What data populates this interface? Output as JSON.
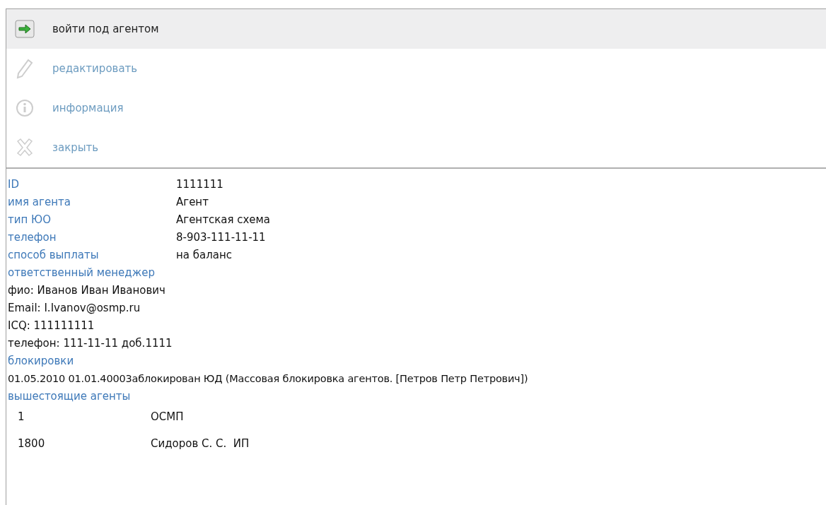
{
  "actions": [
    {
      "kind": "login",
      "label": "войти под агентом",
      "selected": true,
      "disabled": false
    },
    {
      "kind": "edit",
      "label": "редактировать",
      "selected": false,
      "disabled": true
    },
    {
      "kind": "info",
      "label": "информация",
      "selected": false,
      "disabled": true
    },
    {
      "kind": "close",
      "label": "закрыть",
      "selected": false,
      "disabled": true
    }
  ],
  "fields": [
    {
      "label": "ID",
      "value": "1111111"
    },
    {
      "label": "имя агента",
      "value": "Агент"
    },
    {
      "label": "тип ЮО",
      "value": "Агентская схема"
    },
    {
      "label": "телефон",
      "value": "8-903-111-11-11"
    },
    {
      "label": "способ выплаты",
      "value": "на баланс"
    }
  ],
  "manager": {
    "heading": "ответственный менеджер",
    "lines": [
      "фио: Иванов Иван Иванович",
      "Email: I.Ivanov@osmp.ru",
      "ICQ: 111111111",
      "телефон: 111-11-11 доб.1111"
    ]
  },
  "blocks": {
    "heading": "блокировки",
    "lines": [
      "01.05.2010 01.01.40003аблокирован ЮД (Массовая блокировка агентов. [Петров Петр Петрович])"
    ]
  },
  "parents": {
    "heading": "вышестоящие агенты",
    "rows": [
      {
        "id": "1",
        "name": "ОСМП"
      },
      {
        "id": "1800",
        "name": "Сидоров С. С.  ИП"
      }
    ]
  }
}
